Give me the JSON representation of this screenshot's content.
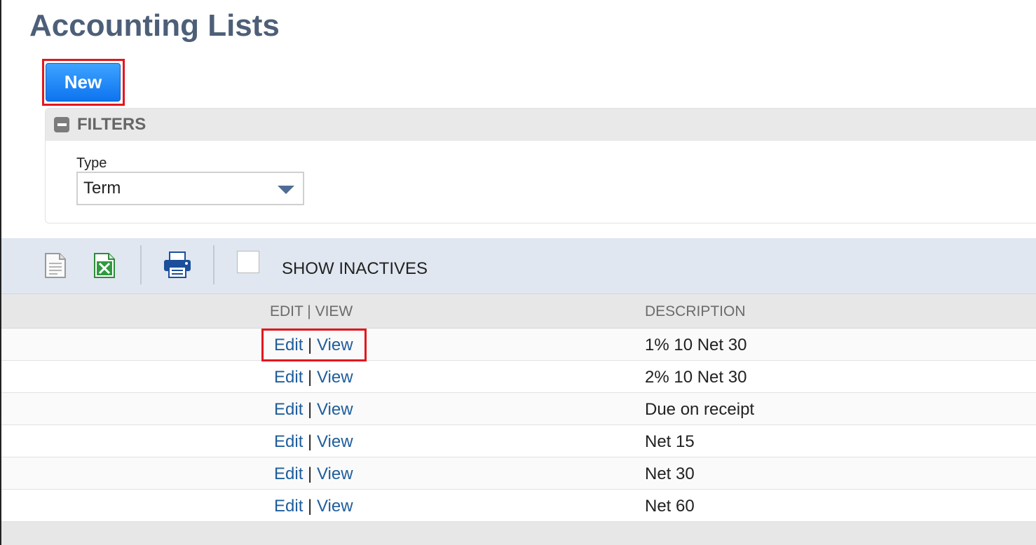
{
  "page": {
    "title": "Accounting Lists",
    "new_button_label": "New"
  },
  "filters": {
    "title": "FILTERS",
    "type_label": "Type",
    "type_value": "Term"
  },
  "toolbar": {
    "icons": [
      "export-doc-icon",
      "export-excel-icon",
      "print-icon"
    ],
    "show_inactives_label": "SHOW INACTIVES",
    "show_inactives_checked": false
  },
  "list": {
    "columns": [
      "EDIT | VIEW",
      "DESCRIPTION"
    ],
    "edit_label": "Edit",
    "separator": "|",
    "view_label": "View",
    "rows": [
      {
        "description": "1% 10 Net 30"
      },
      {
        "description": "2% 10 Net 30"
      },
      {
        "description": "Due on receipt"
      },
      {
        "description": "Net 15"
      },
      {
        "description": "Net 30"
      },
      {
        "description": "Net 60"
      }
    ]
  },
  "colors": {
    "title": "#4d5f78",
    "new_button": "#0d74f0",
    "highlight": "#e3161d",
    "link": "#1f5d9c",
    "toolbar_bg": "#e0e7f1"
  }
}
